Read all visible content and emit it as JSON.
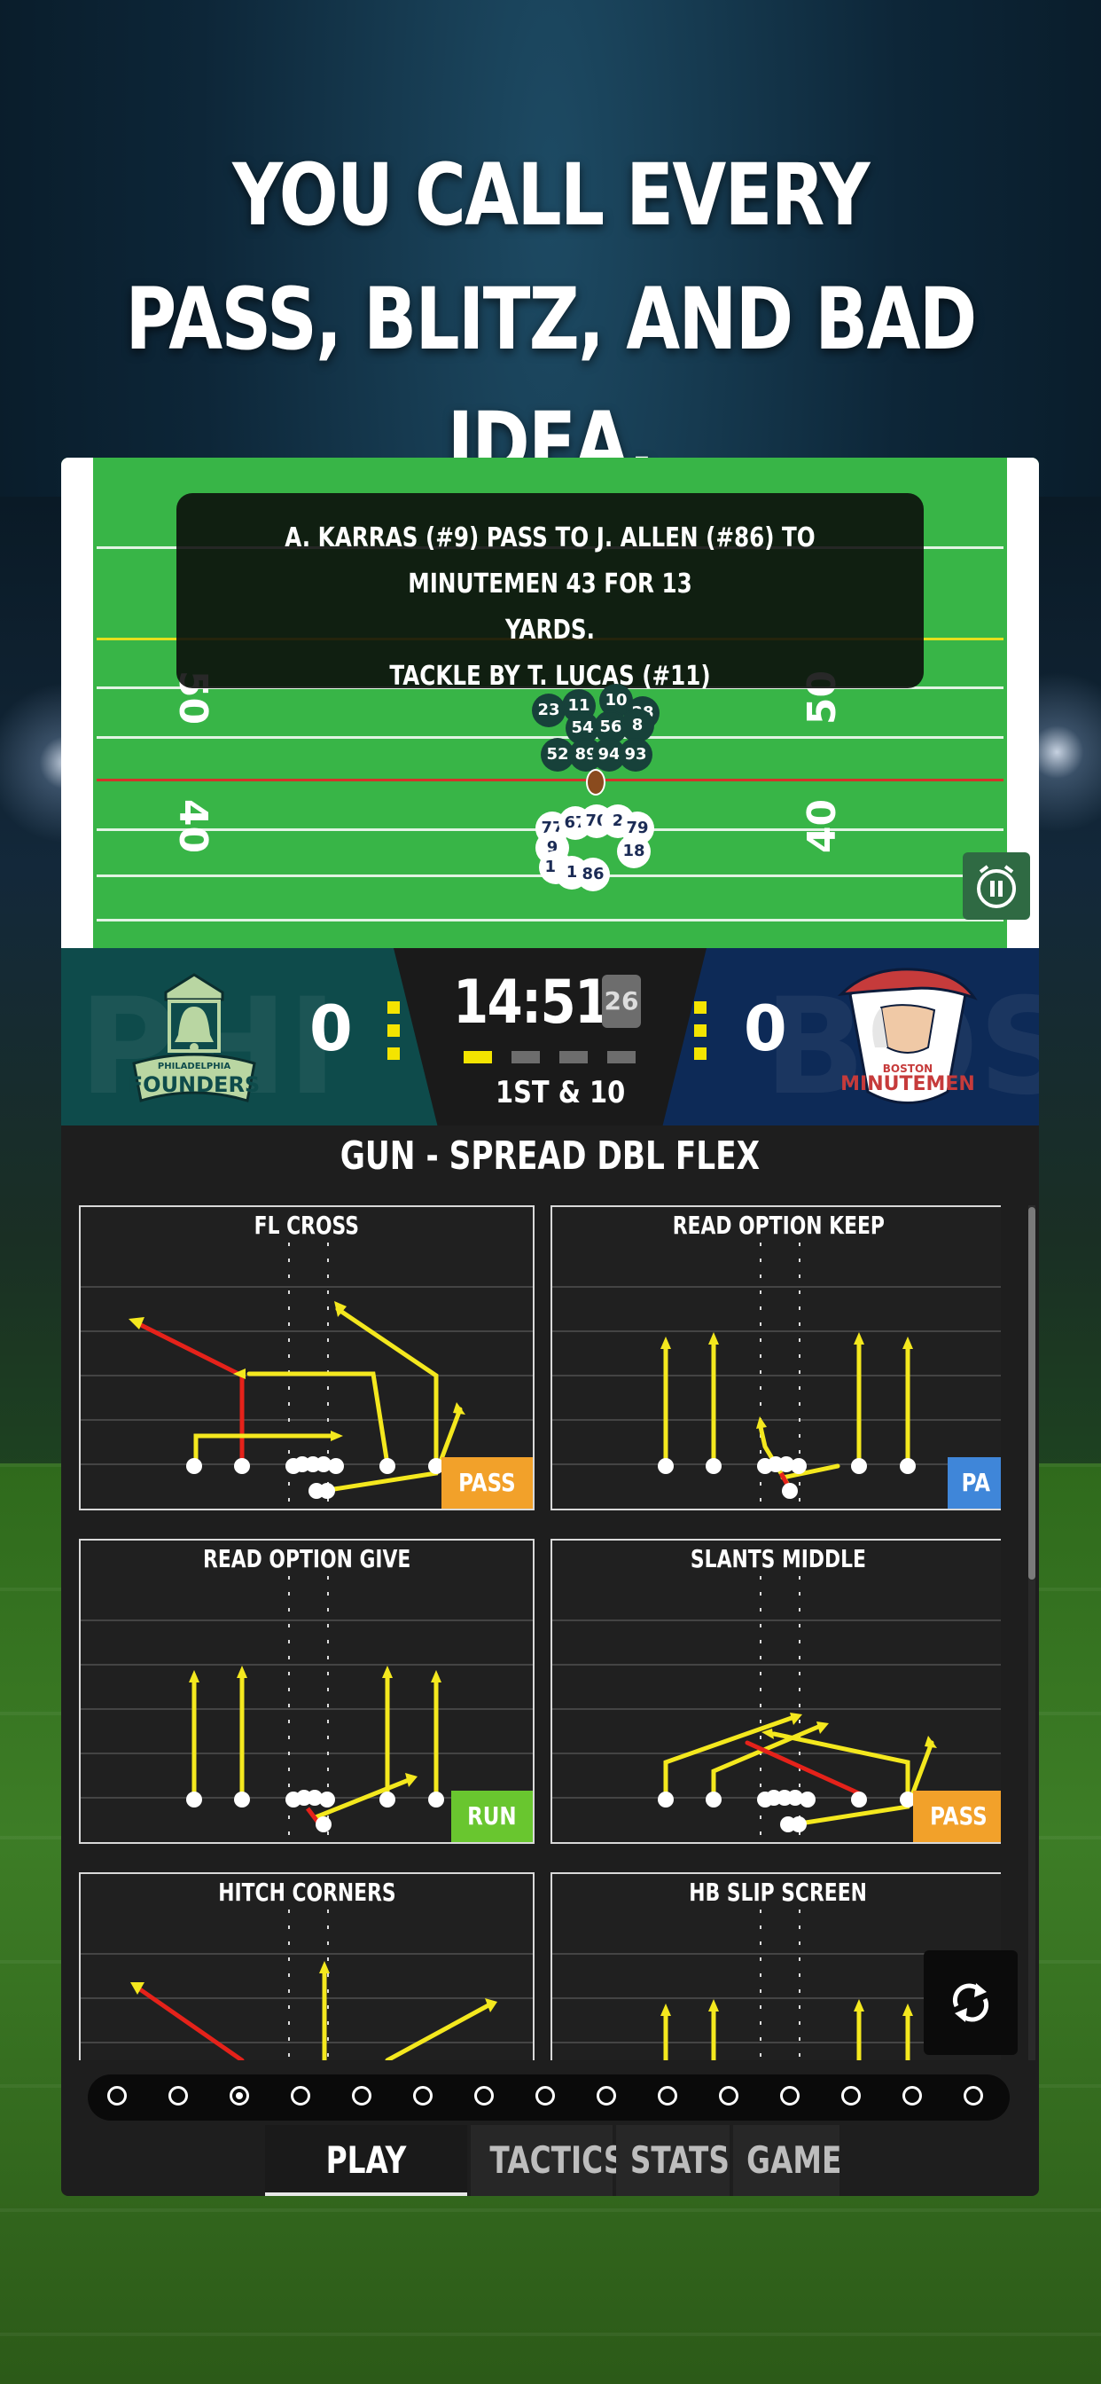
{
  "headline": {
    "line1": "YOU CALL EVERY",
    "line2": "PASS, BLITZ, AND BAD IDEA."
  },
  "field": {
    "yard_numbers": {
      "upper_left": "50",
      "upper_right": "50",
      "lower_left": "40",
      "lower_right": "40"
    },
    "play_log": {
      "line1": "A. KARRAS (#9) PASS TO J. ALLEN (#86) TO MINUTEMEN 43 FOR 13",
      "line2": "YARDS.",
      "line3": "TACKLE BY T. LUCAS (#11)"
    },
    "defense_numbers": [
      "23",
      "11",
      "10",
      "28",
      "54",
      "56",
      "8",
      "52",
      "89",
      "94",
      "93"
    ],
    "offense_numbers": [
      "77",
      "67",
      "70",
      "2",
      "79",
      "9",
      "14",
      "1",
      "86",
      "18"
    ],
    "pause_icon": "pause-timer-icon"
  },
  "scoreboard": {
    "home_score": "0",
    "away_score": "0",
    "home_logo_text": "PHILADELPHIA",
    "home_logo_name": "FOUNDERS",
    "away_logo_text": "BOSTON",
    "away_logo_name": "MINUTEMEN",
    "ghost_home": "PHI",
    "ghost_away": "BOS",
    "game_clock": "14:51",
    "play_clock": "26",
    "down_distance": "1ST & 10",
    "colors": {
      "home": "#0e4b4b",
      "away": "#0d2a57",
      "timeout": "#f4e400"
    }
  },
  "formation": "GUN - SPREAD DBL FLEX",
  "plays": [
    {
      "name": "FL CROSS",
      "tag": "PASS",
      "tag_color": "#f2a12a"
    },
    {
      "name": "READ OPTION KEEP",
      "tag": "PA",
      "tag_color": "#3f86d9"
    },
    {
      "name": "READ OPTION GIVE",
      "tag": "RUN",
      "tag_color": "#69c62f"
    },
    {
      "name": "SLANTS MIDDLE",
      "tag": "PASS",
      "tag_color": "#f2a12a"
    },
    {
      "name": "HITCH CORNERS",
      "tag": "",
      "tag_color": ""
    },
    {
      "name": "HB SLIP SCREEN",
      "tag": "",
      "tag_color": ""
    }
  ],
  "pager": {
    "count": 15,
    "active": 3
  },
  "tabs": [
    {
      "label": "PLAY SHEET",
      "active": true
    },
    {
      "label": "TACTICS",
      "active": false
    },
    {
      "label": "STATS",
      "active": false
    },
    {
      "label": "GAME",
      "active": false
    }
  ]
}
